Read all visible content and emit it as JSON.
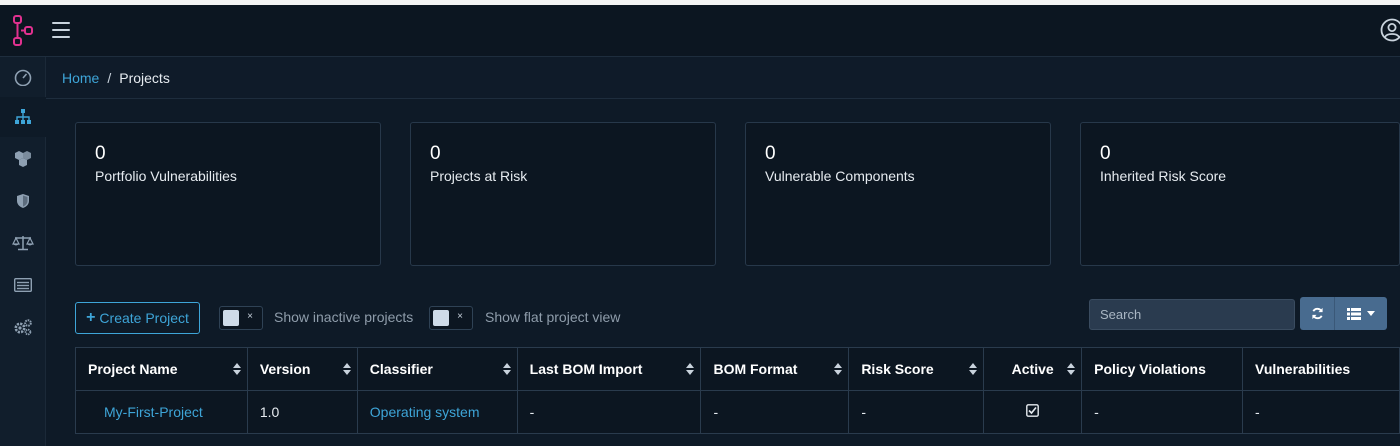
{
  "header": {
    "logo_icon": "dependency-track-logo",
    "menu_icon": "hamburger-menu-icon",
    "user_icon": "user-profile-icon"
  },
  "sidebar": {
    "items": [
      {
        "icon": "dashboard-gauge-icon"
      },
      {
        "icon": "projects-sitemap-icon",
        "active": true
      },
      {
        "icon": "components-cubes-icon"
      },
      {
        "icon": "vulnerabilities-shield-icon"
      },
      {
        "icon": "policy-balance-icon"
      },
      {
        "icon": "tasks-list-icon"
      },
      {
        "icon": "administration-gears-icon"
      }
    ]
  },
  "breadcrumb": {
    "home": "Home",
    "separator": "/",
    "current": "Projects"
  },
  "cards": [
    {
      "value": "0",
      "label": "Portfolio Vulnerabilities"
    },
    {
      "value": "0",
      "label": "Projects at Risk"
    },
    {
      "value": "0",
      "label": "Vulnerable Components"
    },
    {
      "value": "0",
      "label": "Inherited Risk Score"
    }
  ],
  "toolbar": {
    "create_label": "Create Project",
    "toggle_x": "×",
    "inactive_label": "Show inactive projects",
    "flat_label": "Show flat project view",
    "search_placeholder": "Search"
  },
  "table": {
    "headers": [
      "Project Name",
      "Version",
      "Classifier",
      "Last BOM Import",
      "BOM Format",
      "Risk Score",
      "Active",
      "Policy Violations",
      "Vulnerabilities"
    ],
    "rows": [
      {
        "name": "My-First-Project",
        "version": "1.0",
        "classifier": "Operating system",
        "last_bom": "-",
        "bom_format": "-",
        "risk_score": "-",
        "active": true,
        "policy_violations": "-",
        "vulnerabilities": "-"
      }
    ]
  },
  "colors": {
    "accent": "#3ea5d8",
    "brand": "#e0318f",
    "background": "#0e1a27",
    "button": "#486b8f"
  }
}
